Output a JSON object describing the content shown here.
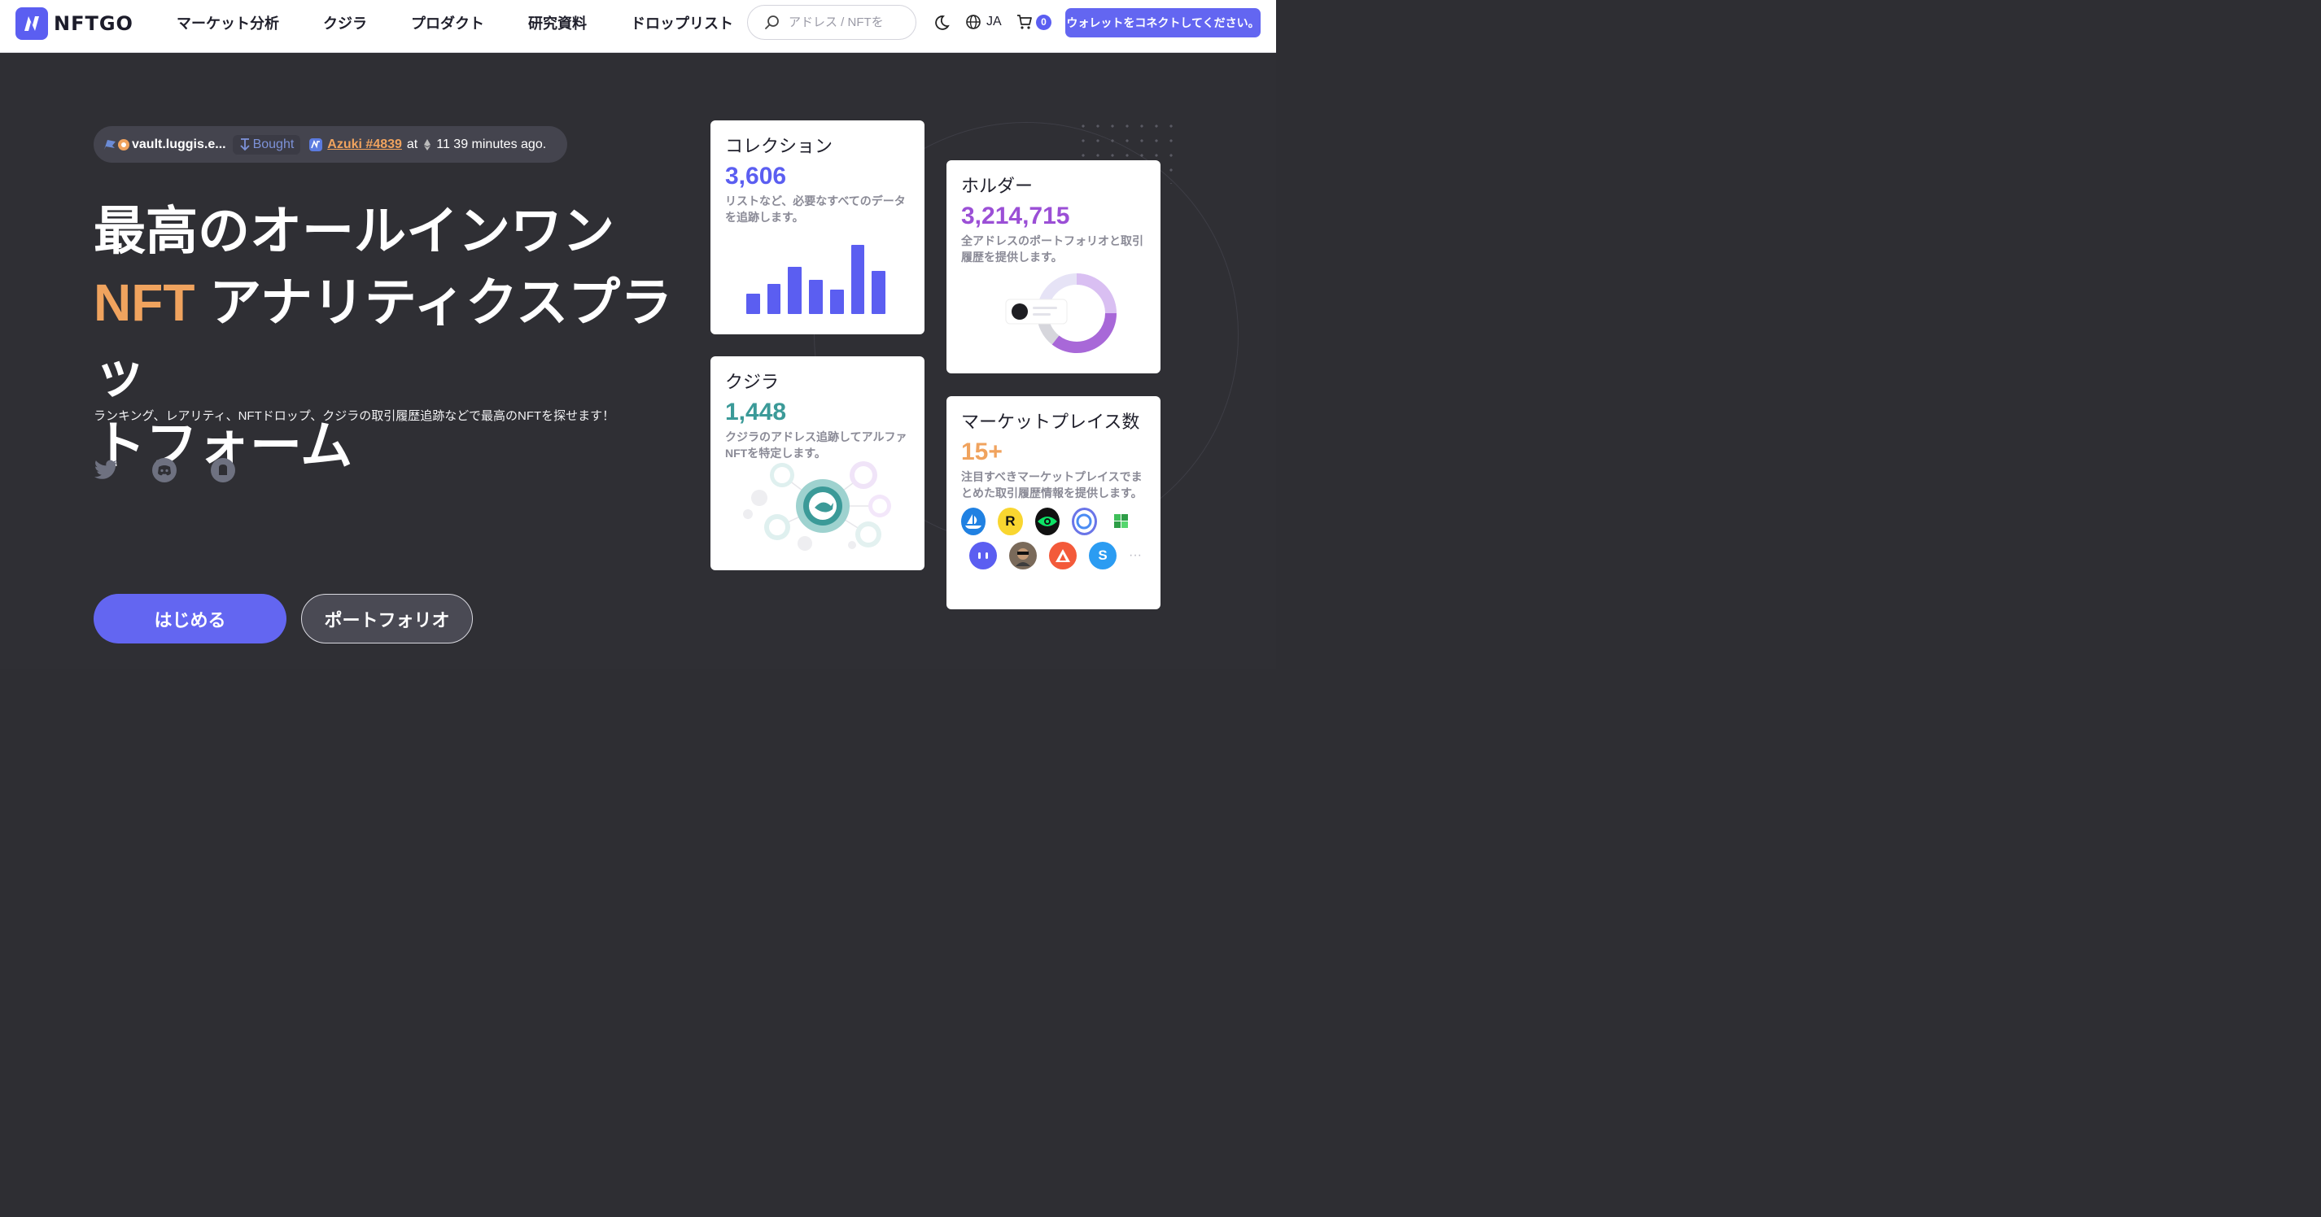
{
  "header": {
    "logo_text": "NFTGO",
    "nav": [
      "マーケット分析",
      "クジラ",
      "プロダクト",
      "研究資料",
      "ドロップリスト"
    ],
    "search_placeholder": "アドレス / NFTを",
    "lang": "JA",
    "cart_count": "0",
    "connect_label": "ウォレットをコネクトしてください。"
  },
  "ticker": {
    "user": "vault.luggis.e...",
    "action": "Bought",
    "nft": "Azuki #4839",
    "at": "at",
    "tail": "11 39 minutes ago."
  },
  "hero": {
    "line1": "最高のオールインワン",
    "accent": "NFT",
    "line2": " アナリティクスプラッ",
    "line3": "トフォーム",
    "subline": "ランキング、レアリティ、NFTドロップ、クジラの取引履歴追跡などで最高のNFTを探せます！",
    "start_label": "はじめる",
    "portfolio_label": "ポートフォリオ"
  },
  "cards": {
    "collection": {
      "title": "コレクション",
      "value": "3,606",
      "desc": "リストなど、必要なすべてのデータを追跡します。",
      "color": "#5b5ef1"
    },
    "holders": {
      "title": "ホルダー",
      "value": "3,214,715",
      "desc": "全アドレスのポートフォリオと取引履歴を提供します。",
      "color": "#9b4fd6"
    },
    "whales": {
      "title": "クジラ",
      "value": "1,448",
      "desc": "クジラのアドレス追跡してアルファNFTを特定します。",
      "color": "#3b9a98"
    },
    "markets": {
      "title": "マーケットプレイス数",
      "value": "15+",
      "desc": "注目すべきマーケットプレイスでまとめた取引履歴情報を提供します。",
      "color": "#f0a35e",
      "more": "···"
    }
  },
  "colors": {
    "accent": "#6366f1",
    "orange": "#f0a35e",
    "bg": "#2f2f34"
  }
}
